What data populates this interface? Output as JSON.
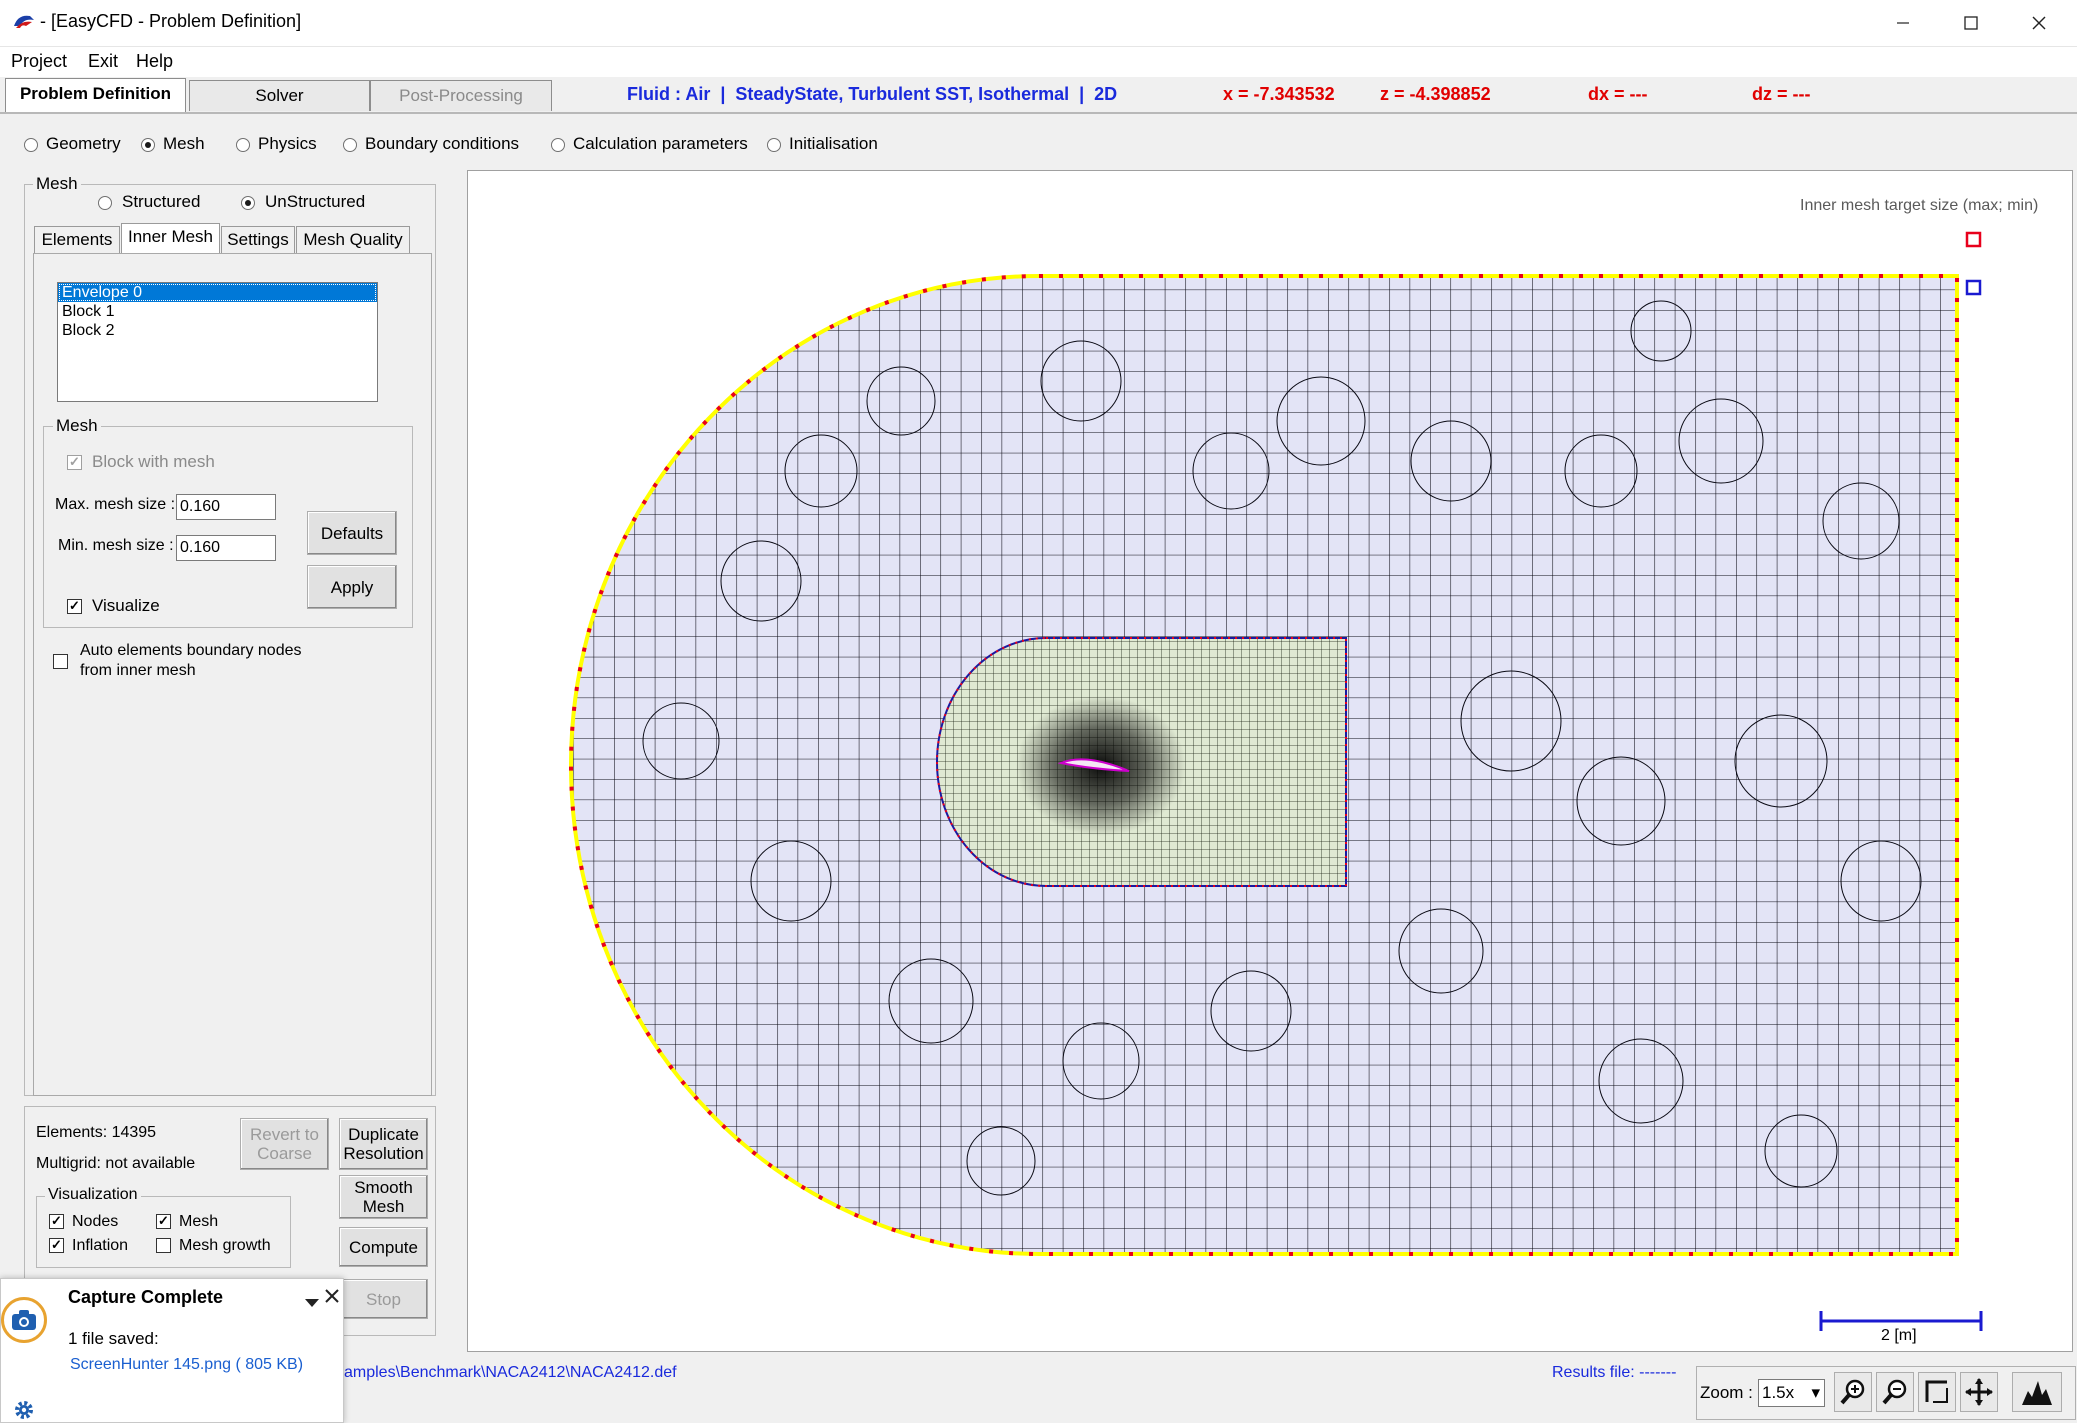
{
  "window": {
    "title": "- [EasyCFD - Problem Definition]"
  },
  "menu": [
    "Project",
    "Exit",
    "Help"
  ],
  "main_tabs": [
    "Problem Definition",
    "Solver",
    "Post-Processing"
  ],
  "status": {
    "fluid": "Fluid : Air  |  SteadyState, Turbulent SST, Isothermal  |  2D",
    "x": "x = -7.343532",
    "z": "z = -4.398852",
    "dx": "dx = ---",
    "dz": "dz = ---"
  },
  "modes": {
    "options": [
      "Geometry",
      "Mesh",
      "Physics",
      "Boundary conditions",
      "Calculation parameters",
      "Initialisation"
    ],
    "selected": "Mesh"
  },
  "mesh_panel": {
    "group_label": "Mesh",
    "structured_label": "Structured",
    "unstructured_label": "UnStructured",
    "selected_type": "UnStructured",
    "subtabs": [
      "Elements",
      "Inner Mesh",
      "Settings",
      "Mesh Quality"
    ],
    "active_subtab": "Inner Mesh",
    "blocks": [
      "Envelope 0",
      "Block 1",
      "Block 2"
    ],
    "selected_block": "Envelope 0",
    "inner_group_label": "Mesh",
    "block_with_mesh_label": "Block with mesh",
    "max_label": "Max. mesh size :",
    "max_value": "0.160",
    "min_label": "Min. mesh size :",
    "min_value": "0.160",
    "defaults_label": "Defaults",
    "apply_label": "Apply",
    "visualize_label": "Visualize",
    "auto_label_1": "Auto elements boundary nodes",
    "auto_label_2": "from inner mesh"
  },
  "bottom_panel": {
    "elements": "Elements: 14395",
    "multigrid": "Multigrid: not available",
    "revert_label_1": "Revert to",
    "revert_label_2": "Coarse",
    "duplicate_label_1": "Duplicate",
    "duplicate_label_2": "Resolution",
    "smooth_label_1": "Smooth",
    "smooth_label_2": "Mesh",
    "compute_label": "Compute",
    "stop_label": "Stop",
    "visualization_label": "Visualization",
    "nodes_label": "Nodes",
    "mesh_label": "Mesh",
    "inflation_label": "Inflation",
    "mesh_growth_label": "Mesh growth"
  },
  "canvas": {
    "legend_label": "Inner mesh target size (max; min)",
    "scale_label": "2  [m]",
    "colors": {
      "boundary": "#ffff00",
      "nodes": "#e8001c",
      "outer_fill": "#e3e4f6",
      "inner_fill": "#dfe9d2",
      "inner_boundary": "#1a1aa0",
      "airfoil": "#cc00cc"
    }
  },
  "footer": {
    "path": "amples\\Benchmark\\NACA2412\\NACA2412.def",
    "results": "Results file: -------",
    "zoom_label": "Zoom :",
    "zoom_value": "1.5x"
  },
  "notification": {
    "title": "Capture Complete",
    "message": "1 file saved:",
    "file": "ScreenHunter 145.png  ( 805 KB)"
  }
}
